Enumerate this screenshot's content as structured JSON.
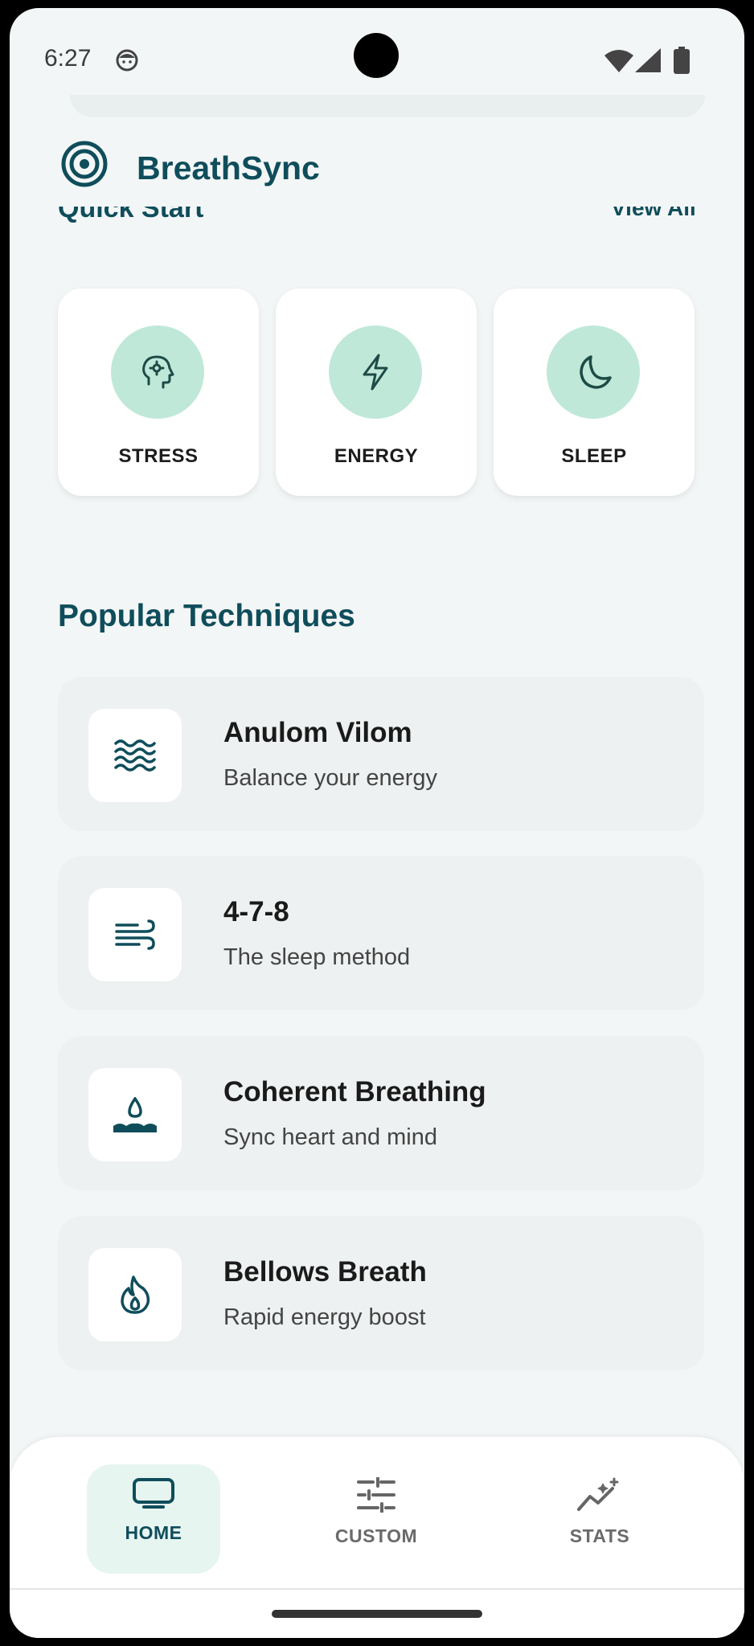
{
  "status_bar": {
    "time": "6:27"
  },
  "header": {
    "app_name": "BreathSync"
  },
  "quick_start": {
    "title": "Quick Start",
    "view_all": "View All",
    "cards": [
      {
        "label": "STRESS",
        "icon": "head-gear-icon"
      },
      {
        "label": "ENERGY",
        "icon": "bolt-icon"
      },
      {
        "label": "SLEEP",
        "icon": "moon-icon"
      }
    ]
  },
  "popular": {
    "title": "Popular Techniques",
    "items": [
      {
        "name": "Anulom Vilom",
        "desc": "Balance your energy",
        "icon": "waves-icon"
      },
      {
        "name": "4-7-8",
        "desc": "The sleep method",
        "icon": "wind-icon"
      },
      {
        "name": "Coherent Breathing",
        "desc": "Sync heart and mind",
        "icon": "water-drop-icon"
      },
      {
        "name": "Bellows Breath",
        "desc": "Rapid energy boost",
        "icon": "flame-icon"
      }
    ]
  },
  "nav": {
    "items": [
      {
        "label": "HOME",
        "icon": "monitor-icon",
        "active": true
      },
      {
        "label": "CUSTOM",
        "icon": "sliders-icon",
        "active": false
      },
      {
        "label": "STATS",
        "icon": "chart-sparkle-icon",
        "active": false
      }
    ]
  },
  "colors": {
    "brand": "#0f4d5b",
    "accent_circle": "#bfe8d9",
    "background": "#f3f6f6",
    "nav_active_bg": "#e7f5f1"
  }
}
